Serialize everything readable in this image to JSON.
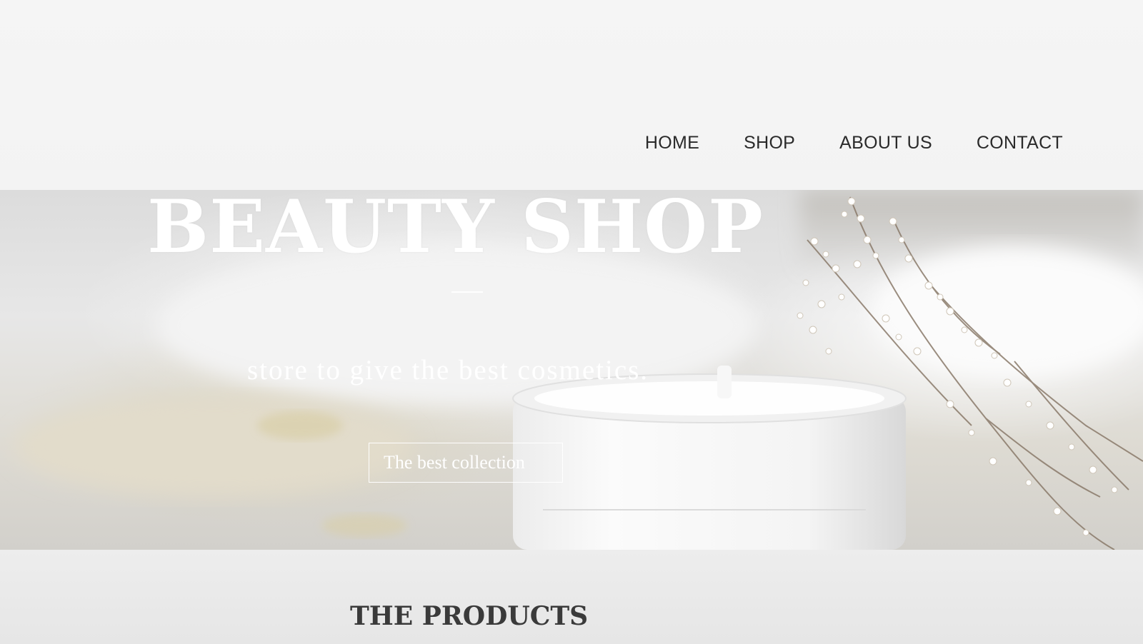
{
  "nav": {
    "items": [
      {
        "label": "HOME"
      },
      {
        "label": "SHOP"
      },
      {
        "label": "ABOUT US"
      },
      {
        "label": "CONTACT"
      }
    ]
  },
  "hero": {
    "title": "BEAUTY SHOP",
    "subtitle": "store to give the best cosmetics.",
    "button_label": "The best collection"
  },
  "products": {
    "heading": "THE PRODUCTS"
  },
  "colors": {
    "header_bg": "#f4f4f4",
    "nav_text": "#2a2a2a",
    "hero_text": "#ffffff",
    "heading_text": "#3a3a3a"
  }
}
